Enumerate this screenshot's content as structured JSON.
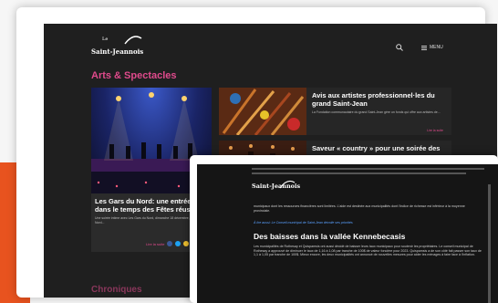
{
  "back_site": {
    "logo_small": "Le",
    "logo_name": "Saint-Jeannois",
    "menu_label": "MENU",
    "section_title": "Arts & Spectacles",
    "feature": {
      "title": "Les Gars du Nord: une entrée dans le temps des Fêtes réussie!",
      "excerpt": "Une soirée intime avec Les Gars du Nord, dimanche 18 décembre, Les Gars du Nord...",
      "read_more": "Lire la suite"
    },
    "articles": [
      {
        "title": "Avis aux artistes professionnel·les du grand Saint-Jean",
        "excerpt": "La Fondation communautaire du grand Saint-Jean gère un fonds qui offre aux artistes de...",
        "read_more": "Lire la suite"
      },
      {
        "title": "Saveur « country » pour une soirée des",
        "excerpt": "",
        "read_more": ""
      }
    ],
    "next_section": "Chroniques"
  },
  "front_site": {
    "logo_name": "Saint-Jeannois",
    "intro": "municipaux dont les ressources financières sont limitées. L'aide est destinée aux municipalités dont l'indice de richesse est inférieur à la moyenne provinciale.",
    "link": "À lire aussi: Le Conseil municipal de Saint-Jean dévoile ses priorités",
    "heading": "Des baisses dans la vallée Kennebecasis",
    "body": "Les municipalités de Rothesay et Quispamsis ont aussi décidé de baisser leurs taux municipaux pour soutenir les propriétaires. Le conseil municipal de Rothesay a approuvé de diminuer le taux de 1,16 à 1,08 par tranche de 100$ de valeur foncière pour 2023. Quispamsis a de son côté fait passer son taux de 1,1 à 1,05 par tranche de 100$. Mieux encore, les deux municipalités ont annoncé de nouvelles mesures pour aider les ménages à faire face à l'inflation."
  },
  "colors": {
    "accent": "#e8531f",
    "section_pink": "#e04a8c",
    "dark_bg": "#1f1f1f"
  },
  "icons": [
    "search-icon",
    "menu-icon",
    "facebook-icon",
    "twitter-icon",
    "share-icon"
  ]
}
